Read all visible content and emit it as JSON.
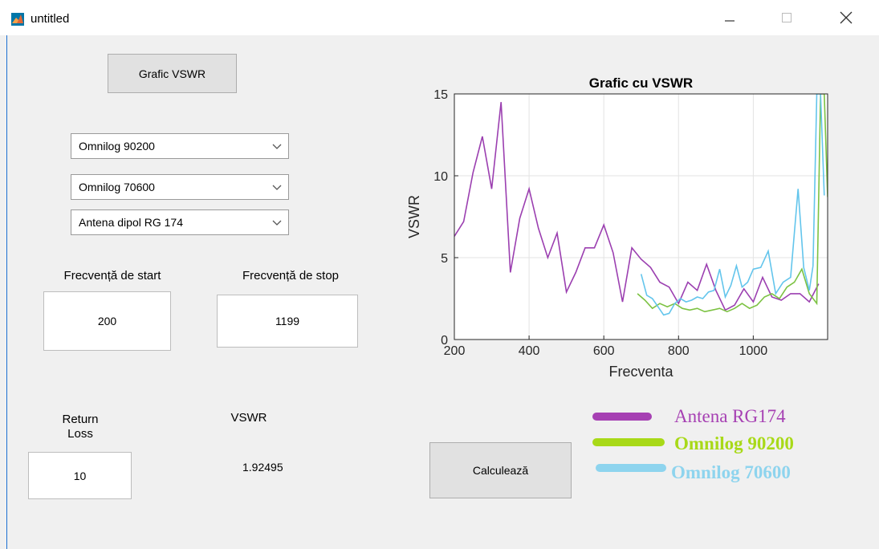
{
  "window": {
    "title": "untitled",
    "minimize": "—",
    "maximize": "☐",
    "close": "✕"
  },
  "grafic_button": {
    "label": "Grafic VSWR"
  },
  "dropdowns": [
    {
      "value": "Omnilog 90200"
    },
    {
      "value": "Omnilog 70600"
    },
    {
      "value": "Antena dipol RG 174"
    }
  ],
  "frequency": {
    "start_label": "Frecvență de start",
    "stop_label": "Frecvență de stop",
    "start_value": "200",
    "stop_value": "1199"
  },
  "return_loss": {
    "label": "Return\nLoss",
    "value": "10"
  },
  "vswr": {
    "label": "VSWR",
    "value": "1.92495"
  },
  "calculate_button": {
    "label": "Calculează"
  },
  "legend": [
    {
      "label": "Antena RG174",
      "color": "#a640b3"
    },
    {
      "label": "Omnilog 90200",
      "color": "#a8d918"
    },
    {
      "label": "Omnilog 70600",
      "color": "#8ed4ee"
    }
  ],
  "chart_data": {
    "type": "line",
    "title": "Grafic cu VSWR",
    "xlabel": "Frecventa",
    "ylabel": "VSWR",
    "xlim": [
      200,
      1199
    ],
    "ylim": [
      0,
      15
    ],
    "xticks": [
      "200",
      "400",
      "600",
      "800",
      "1000"
    ],
    "yticks": [
      "0",
      "5",
      "10",
      "15"
    ],
    "grid": true,
    "series": [
      {
        "name": "Antena RG174",
        "color": "#9b3fb0",
        "x": [
          200,
          225,
          250,
          275,
          300,
          325,
          350,
          375,
          400,
          425,
          450,
          475,
          500,
          525,
          550,
          575,
          600,
          625,
          650,
          675,
          700,
          725,
          750,
          775,
          800,
          825,
          850,
          875,
          900,
          925,
          950,
          975,
          1000,
          1025,
          1050,
          1075,
          1100,
          1125,
          1150,
          1175
        ],
        "y": [
          6.3,
          7.2,
          10.2,
          12.4,
          9.2,
          14.5,
          4.1,
          7.4,
          9.2,
          6.8,
          5.0,
          6.5,
          2.9,
          4.1,
          5.6,
          5.6,
          7.0,
          5.3,
          2.3,
          5.6,
          4.9,
          4.4,
          3.5,
          3.2,
          2.2,
          3.5,
          3.0,
          4.6,
          3.0,
          1.8,
          2.1,
          3.1,
          2.3,
          3.8,
          2.6,
          2.4,
          2.8,
          2.8,
          2.3,
          3.4
        ]
      },
      {
        "name": "Omnilog 90200",
        "color": "#7cc242",
        "x": [
          690,
          710,
          730,
          750,
          770,
          790,
          810,
          830,
          850,
          870,
          890,
          910,
          930,
          950,
          970,
          990,
          1010,
          1030,
          1050,
          1070,
          1090,
          1110,
          1130,
          1150,
          1170,
          1180,
          1190,
          1199
        ],
        "y": [
          2.8,
          2.4,
          1.9,
          2.2,
          2.0,
          2.2,
          1.9,
          1.8,
          1.9,
          1.7,
          1.8,
          1.9,
          1.7,
          1.9,
          2.2,
          1.9,
          2.1,
          2.6,
          2.8,
          2.5,
          3.2,
          3.5,
          4.3,
          2.8,
          2.2,
          15,
          15,
          8.7
        ]
      },
      {
        "name": "Omnilog 70600",
        "color": "#63c5ec",
        "x": [
          700,
          715,
          730,
          745,
          760,
          775,
          790,
          805,
          820,
          835,
          850,
          865,
          880,
          895,
          910,
          925,
          940,
          955,
          970,
          985,
          1000,
          1020,
          1040,
          1060,
          1080,
          1100,
          1120,
          1135,
          1150,
          1160,
          1170,
          1180,
          1190
        ],
        "y": [
          4.0,
          2.7,
          2.5,
          2.0,
          1.5,
          1.6,
          2.2,
          2.5,
          2.3,
          2.4,
          2.6,
          2.5,
          2.9,
          3.0,
          4.3,
          2.6,
          3.3,
          4.5,
          3.2,
          3.5,
          4.3,
          4.4,
          5.4,
          2.8,
          3.5,
          3.8,
          9.2,
          4.4,
          3.0,
          4.5,
          15,
          15,
          8.8
        ]
      }
    ]
  }
}
